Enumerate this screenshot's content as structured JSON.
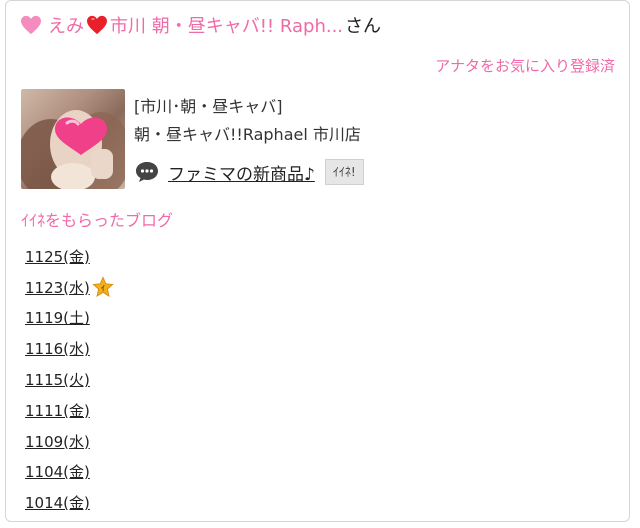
{
  "header": {
    "name": "えみ",
    "shop": "市川 朝・昼キャバ!! Raph...",
    "suffix": "さん"
  },
  "favorite_link": "アナタをお気に入り登録済",
  "profile": {
    "shop_line1": "[市川･朝・昼キャバ]",
    "shop_line2": "朝・昼キャバ!!Raphael 市川店"
  },
  "latest_blog": {
    "title": "ファミマの新商品♪",
    "iine_label": "ｲｲﾈ!"
  },
  "section_title": "ｲｲﾈをもらったブログ",
  "blog_dates": [
    {
      "label": "1125(金)",
      "star": false
    },
    {
      "label": "1123(水)",
      "star": true
    },
    {
      "label": "1119(土)",
      "star": false
    },
    {
      "label": "1116(水)",
      "star": false
    },
    {
      "label": "1115(火)",
      "star": false
    },
    {
      "label": "1111(金)",
      "star": false
    },
    {
      "label": "1109(水)",
      "star": false
    },
    {
      "label": "1104(金)",
      "star": false
    },
    {
      "label": "1014(金)",
      "star": false
    }
  ],
  "colors": {
    "accent_pink": "#f06aa8",
    "heart_red": "#e8202a",
    "star_gold": "#f2b01e"
  },
  "icons": {
    "heart1": "pink-heart-icon",
    "heart2": "red-heart-icon",
    "chat": "speech-bubble-icon",
    "star": "gold-star-icon"
  }
}
